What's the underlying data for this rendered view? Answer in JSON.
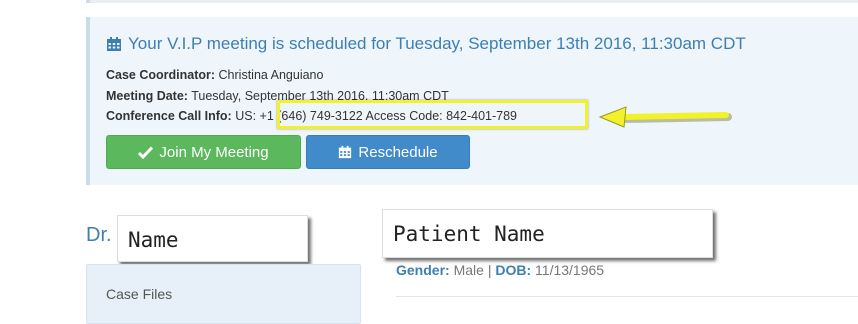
{
  "meeting_alert": {
    "title": "Your V.I.P meeting is scheduled for Tuesday, September 13th 2016, 11:30am CDT",
    "coordinator_label": "Case Coordinator:",
    "coordinator_value": "Christina Anguiano",
    "date_label": "Meeting Date:",
    "date_value": "Tuesday, September 13th 2016, 11:30am CDT",
    "call_label": "Conference Call Info:",
    "call_prefix": "US:",
    "call_value": "+1 (646) 749-3122 Access Code: 842-401-789",
    "join_button": "Join My Meeting",
    "reschedule_button": "Reschedule"
  },
  "doctor": {
    "prefix": "Dr.",
    "name": "Name"
  },
  "patient": {
    "name": "Patient Name",
    "gender_label": "Gender:",
    "gender_value": "Male",
    "separator": "|",
    "dob_label": "DOB:",
    "dob_value": "11/13/1965"
  },
  "sidebar": {
    "case_files": "Case Files"
  },
  "icons": {
    "calendar": "calendar-icon",
    "check": "check-icon"
  },
  "colors": {
    "alert_bg": "#eef5fb",
    "title_blue": "#3e7fb0",
    "join_green": "#5cb85c",
    "reschedule_blue": "#428bca",
    "highlight_yellow": "#f2f22a"
  }
}
